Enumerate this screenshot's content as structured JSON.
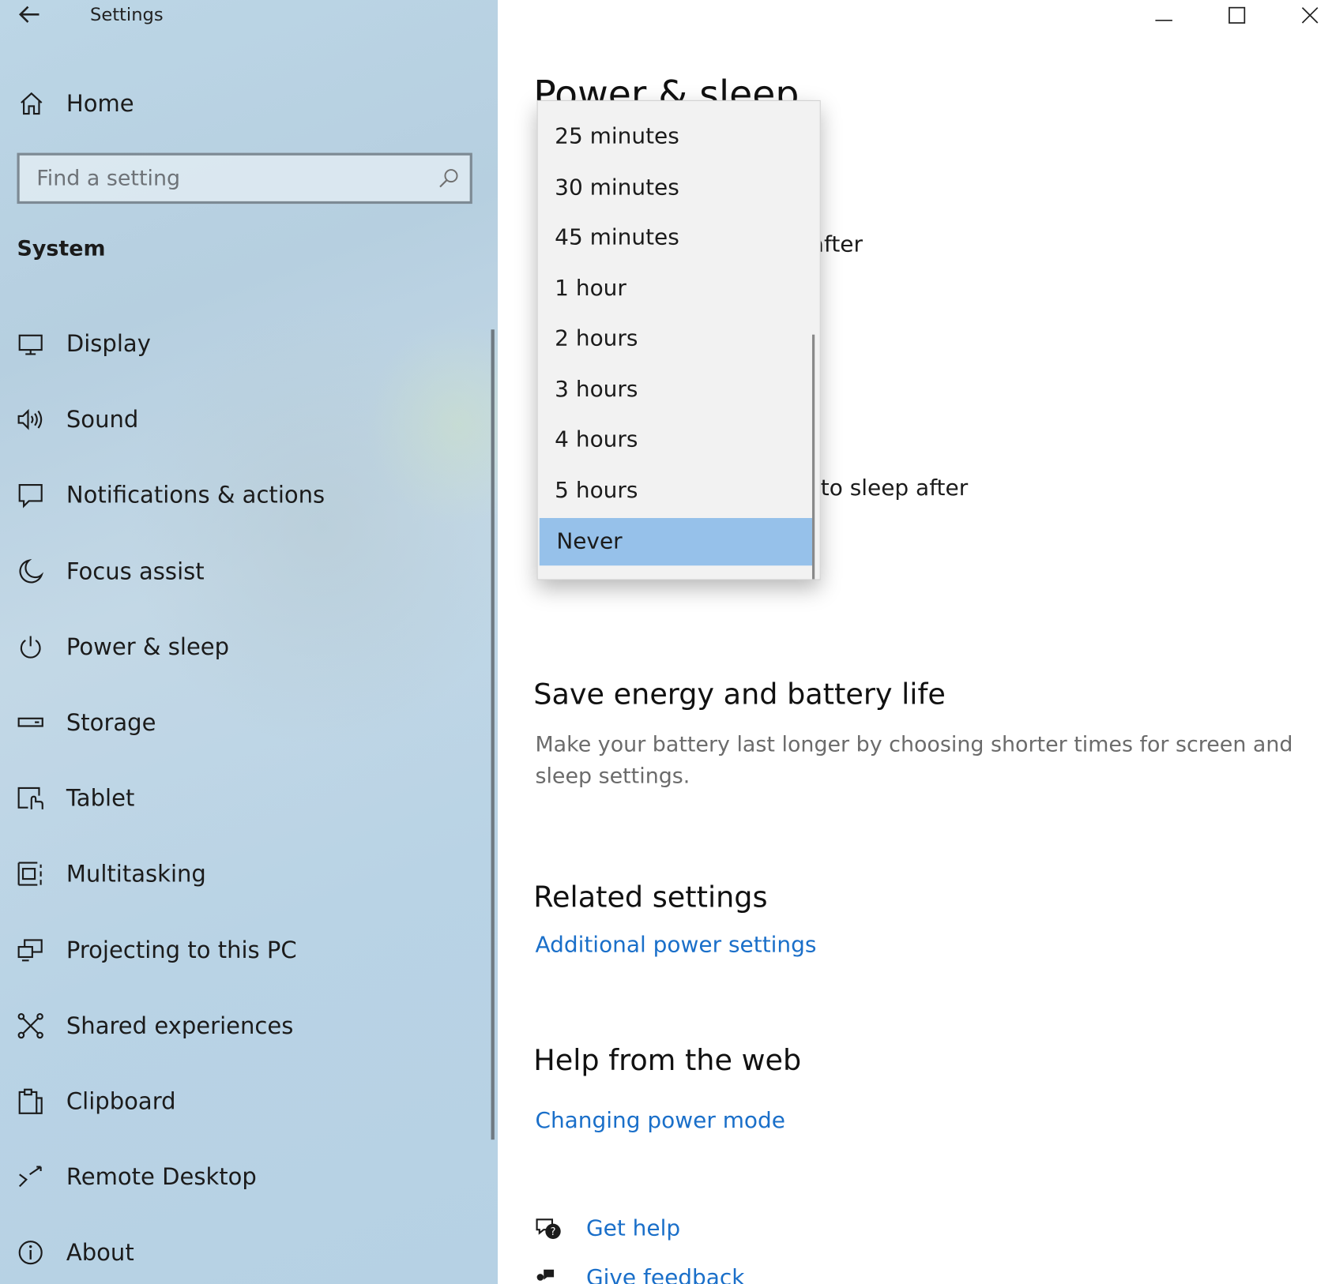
{
  "window": {
    "title": "Settings",
    "controls": [
      "minimize-icon",
      "maximize-icon",
      "close-icon"
    ]
  },
  "sidebar": {
    "home_label": "Home",
    "search_placeholder": "Find a setting",
    "section_title": "System",
    "items": [
      {
        "label": "Display",
        "icon": "display-icon"
      },
      {
        "label": "Sound",
        "icon": "speaker-icon"
      },
      {
        "label": "Notifications & actions",
        "icon": "notification-icon"
      },
      {
        "label": "Focus assist",
        "icon": "moon-icon"
      },
      {
        "label": "Power & sleep",
        "icon": "power-icon"
      },
      {
        "label": "Storage",
        "icon": "storage-icon"
      },
      {
        "label": "Tablet",
        "icon": "tablet-icon"
      },
      {
        "label": "Multitasking",
        "icon": "multitasking-icon"
      },
      {
        "label": "Projecting to this PC",
        "icon": "projecting-icon"
      },
      {
        "label": "Shared experiences",
        "icon": "shared-icon"
      },
      {
        "label": "Clipboard",
        "icon": "clipboard-icon"
      },
      {
        "label": "Remote Desktop",
        "icon": "remote-desktop-icon"
      },
      {
        "label": "About",
        "icon": "info-icon"
      }
    ]
  },
  "main": {
    "page_title": "Power & sleep",
    "screen_text_fragment": "after",
    "sleep_text_fragment": "to sleep after",
    "save_energy": {
      "heading": "Save energy and battery life",
      "description": "Make your battery last longer by choosing shorter times for screen and sleep settings."
    },
    "related": {
      "heading": "Related settings",
      "link": "Additional power settings"
    },
    "help": {
      "heading": "Help from the web",
      "link": "Changing power mode"
    },
    "get_help": "Get help",
    "give_feedback": "Give feedback"
  },
  "dropdown": {
    "options": [
      "25 minutes",
      "30 minutes",
      "45 minutes",
      "1 hour",
      "2 hours",
      "3 hours",
      "4 hours",
      "5 hours",
      "Never"
    ],
    "selected": "Never"
  },
  "colors": {
    "accent_link": "#1a6fc9",
    "selection": "#96c1ea",
    "sidebar_tint": "#bcd6e6"
  }
}
